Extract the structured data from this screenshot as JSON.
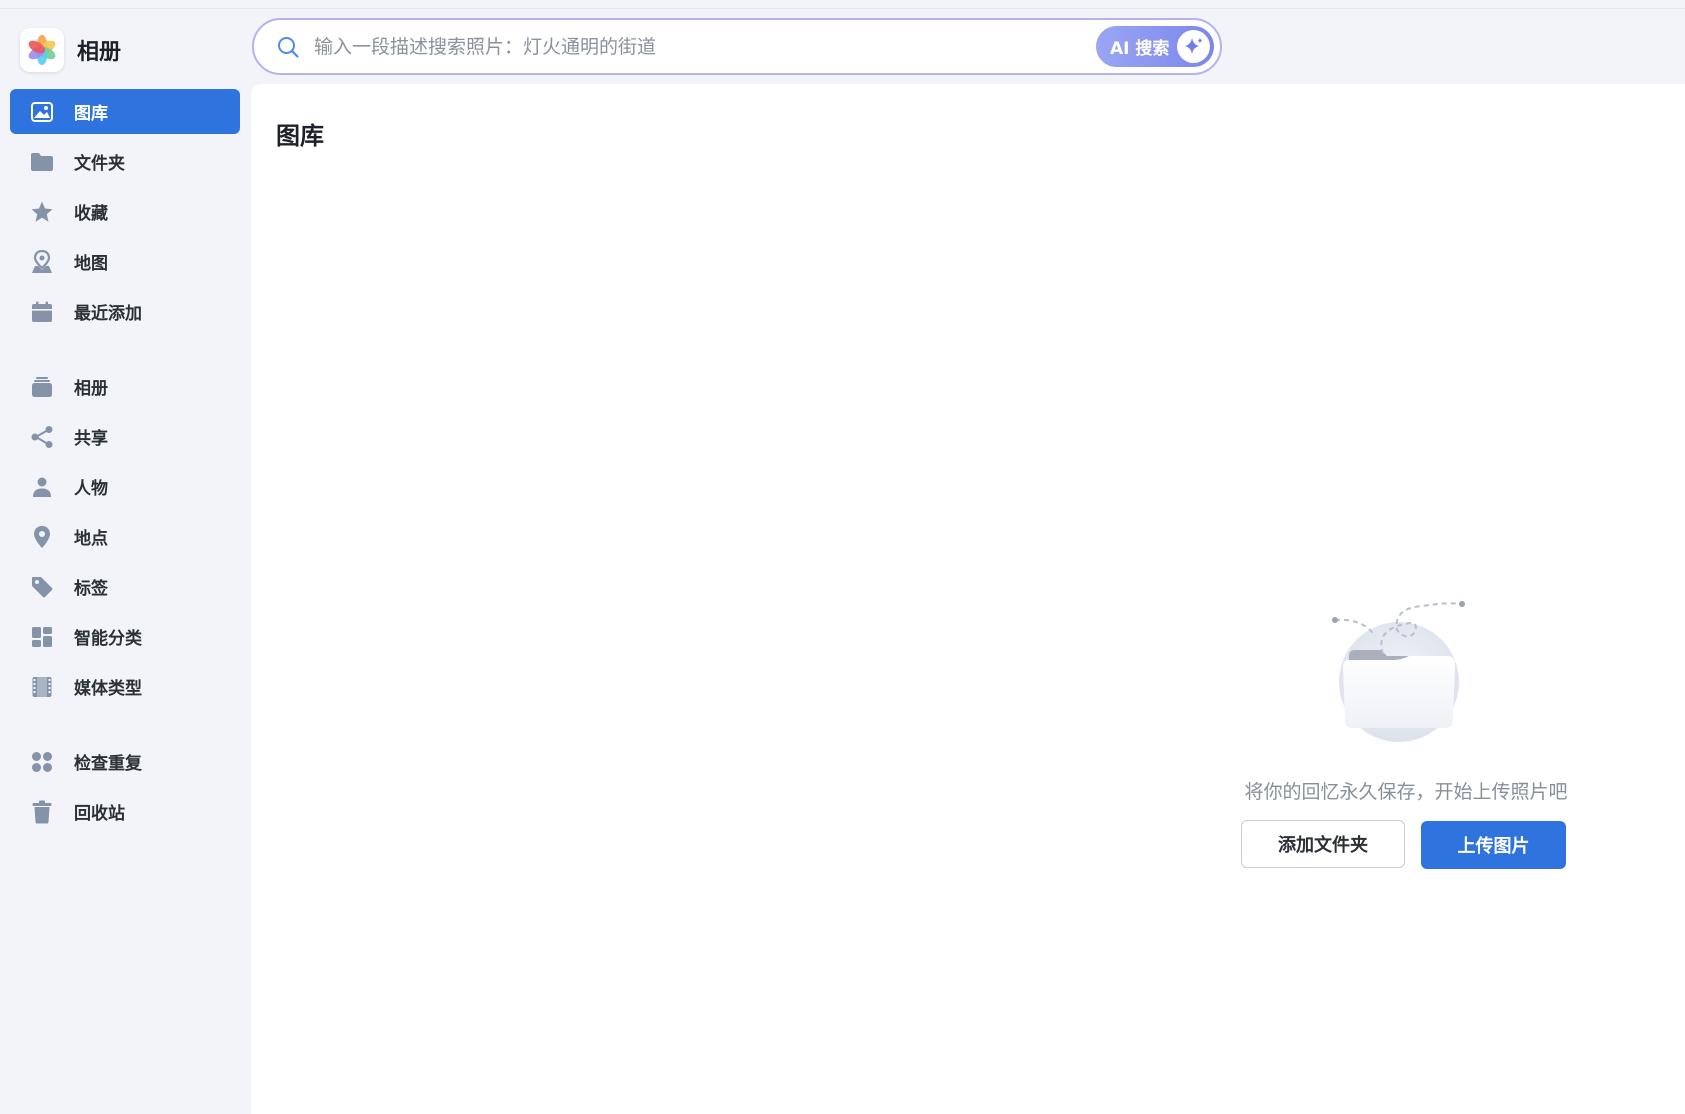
{
  "app": {
    "title": "相册"
  },
  "search": {
    "placeholder": "输入一段描述搜索照片：灯火通明的街道",
    "ai_label": "AI 搜索"
  },
  "sidebar": {
    "items": [
      {
        "label": "图库",
        "icon": "image-icon",
        "active": true
      },
      {
        "label": "文件夹",
        "icon": "folder-icon"
      },
      {
        "label": "收藏",
        "icon": "star-icon"
      },
      {
        "label": "地图",
        "icon": "map-pin-icon"
      },
      {
        "label": "最近添加",
        "icon": "calendar-icon"
      },
      {
        "label": "相册",
        "icon": "album-stack-icon"
      },
      {
        "label": "共享",
        "icon": "share-icon"
      },
      {
        "label": "人物",
        "icon": "person-icon"
      },
      {
        "label": "地点",
        "icon": "location-icon"
      },
      {
        "label": "标签",
        "icon": "tag-icon"
      },
      {
        "label": "智能分类",
        "icon": "grid-icon"
      },
      {
        "label": "媒体类型",
        "icon": "film-icon"
      },
      {
        "label": "检查重复",
        "icon": "duplicate-icon"
      },
      {
        "label": "回收站",
        "icon": "trash-icon"
      }
    ]
  },
  "main": {
    "title": "图库",
    "empty_text": "将你的回忆永久保存，开始上传照片吧",
    "add_folder_label": "添加文件夹",
    "upload_label": "上传图片"
  },
  "colors": {
    "accent": "#2f74de",
    "sidebar_bg": "#f2f4f9",
    "icon_gray": "#8593a8",
    "ai_gradient_start": "#9aa6f3",
    "ai_gradient_end": "#7b86ee"
  }
}
